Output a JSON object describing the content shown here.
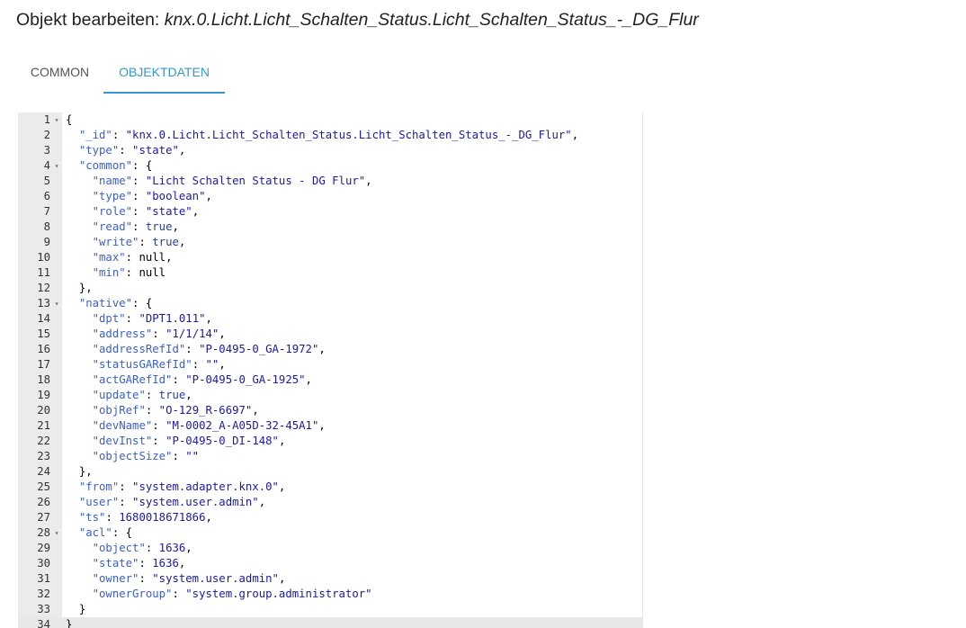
{
  "header": {
    "prefix": "Objekt bearbeiten: ",
    "object_id": "knx.0.Licht.Licht_Schalten_Status.Licht_Schalten_Status_-_DG_Flur"
  },
  "tabs": [
    {
      "label": "COMMON",
      "active": false
    },
    {
      "label": "OBJEKTDATEN",
      "active": true
    }
  ],
  "colors": {
    "accent": "#3399cc",
    "gutter": "#ebebeb",
    "key": "#3a5fcd",
    "string": "#1a1aa6"
  },
  "editor": {
    "lines": [
      {
        "n": "1",
        "fold": true,
        "indent": "",
        "parts": [
          {
            "t": "{",
            "c": "pun"
          }
        ]
      },
      {
        "n": "2",
        "indent": "  ",
        "parts": [
          {
            "t": "\"_id\"",
            "c": "key"
          },
          {
            "t": ": ",
            "c": "pun"
          },
          {
            "t": "\"knx.0.Licht.Licht_Schalten_Status.Licht_Schalten_Status_-_DG_Flur\"",
            "c": "str"
          },
          {
            "t": ",",
            "c": "pun"
          }
        ]
      },
      {
        "n": "3",
        "indent": "  ",
        "parts": [
          {
            "t": "\"type\"",
            "c": "key"
          },
          {
            "t": ": ",
            "c": "pun"
          },
          {
            "t": "\"state\"",
            "c": "str"
          },
          {
            "t": ",",
            "c": "pun"
          }
        ]
      },
      {
        "n": "4",
        "fold": true,
        "indent": "  ",
        "parts": [
          {
            "t": "\"common\"",
            "c": "key"
          },
          {
            "t": ": {",
            "c": "pun"
          }
        ]
      },
      {
        "n": "5",
        "indent": "    ",
        "parts": [
          {
            "t": "\"name\"",
            "c": "key"
          },
          {
            "t": ": ",
            "c": "pun"
          },
          {
            "t": "\"Licht Schalten Status - DG Flur\"",
            "c": "str"
          },
          {
            "t": ",",
            "c": "pun"
          }
        ]
      },
      {
        "n": "6",
        "indent": "    ",
        "parts": [
          {
            "t": "\"type\"",
            "c": "key"
          },
          {
            "t": ": ",
            "c": "pun"
          },
          {
            "t": "\"boolean\"",
            "c": "str"
          },
          {
            "t": ",",
            "c": "pun"
          }
        ]
      },
      {
        "n": "7",
        "indent": "    ",
        "parts": [
          {
            "t": "\"role\"",
            "c": "key"
          },
          {
            "t": ": ",
            "c": "pun"
          },
          {
            "t": "\"state\"",
            "c": "str"
          },
          {
            "t": ",",
            "c": "pun"
          }
        ]
      },
      {
        "n": "8",
        "indent": "    ",
        "parts": [
          {
            "t": "\"read\"",
            "c": "key"
          },
          {
            "t": ": ",
            "c": "pun"
          },
          {
            "t": "true",
            "c": "kw"
          },
          {
            "t": ",",
            "c": "pun"
          }
        ]
      },
      {
        "n": "9",
        "indent": "    ",
        "parts": [
          {
            "t": "\"write\"",
            "c": "key"
          },
          {
            "t": ": ",
            "c": "pun"
          },
          {
            "t": "true",
            "c": "kw"
          },
          {
            "t": ",",
            "c": "pun"
          }
        ]
      },
      {
        "n": "10",
        "indent": "    ",
        "parts": [
          {
            "t": "\"max\"",
            "c": "key"
          },
          {
            "t": ": null,",
            "c": "pun"
          }
        ]
      },
      {
        "n": "11",
        "indent": "    ",
        "parts": [
          {
            "t": "\"min\"",
            "c": "key"
          },
          {
            "t": ": null",
            "c": "pun"
          }
        ]
      },
      {
        "n": "12",
        "indent": "  ",
        "parts": [
          {
            "t": "},",
            "c": "pun"
          }
        ]
      },
      {
        "n": "13",
        "fold": true,
        "indent": "  ",
        "parts": [
          {
            "t": "\"native\"",
            "c": "key"
          },
          {
            "t": ": {",
            "c": "pun"
          }
        ]
      },
      {
        "n": "14",
        "indent": "    ",
        "parts": [
          {
            "t": "\"dpt\"",
            "c": "key"
          },
          {
            "t": ": ",
            "c": "pun"
          },
          {
            "t": "\"DPT1.011\"",
            "c": "str"
          },
          {
            "t": ",",
            "c": "pun"
          }
        ]
      },
      {
        "n": "15",
        "indent": "    ",
        "parts": [
          {
            "t": "\"address\"",
            "c": "key"
          },
          {
            "t": ": ",
            "c": "pun"
          },
          {
            "t": "\"1/1/14\"",
            "c": "str"
          },
          {
            "t": ",",
            "c": "pun"
          }
        ]
      },
      {
        "n": "16",
        "indent": "    ",
        "parts": [
          {
            "t": "\"addressRefId\"",
            "c": "key"
          },
          {
            "t": ": ",
            "c": "pun"
          },
          {
            "t": "\"P-0495-0_GA-1972\"",
            "c": "str"
          },
          {
            "t": ",",
            "c": "pun"
          }
        ]
      },
      {
        "n": "17",
        "indent": "    ",
        "parts": [
          {
            "t": "\"statusGARefId\"",
            "c": "key"
          },
          {
            "t": ": ",
            "c": "pun"
          },
          {
            "t": "\"\"",
            "c": "str"
          },
          {
            "t": ",",
            "c": "pun"
          }
        ]
      },
      {
        "n": "18",
        "indent": "    ",
        "parts": [
          {
            "t": "\"actGARefId\"",
            "c": "key"
          },
          {
            "t": ": ",
            "c": "pun"
          },
          {
            "t": "\"P-0495-0_GA-1925\"",
            "c": "str"
          },
          {
            "t": ",",
            "c": "pun"
          }
        ]
      },
      {
        "n": "19",
        "indent": "    ",
        "parts": [
          {
            "t": "\"update\"",
            "c": "key"
          },
          {
            "t": ": ",
            "c": "pun"
          },
          {
            "t": "true",
            "c": "kw"
          },
          {
            "t": ",",
            "c": "pun"
          }
        ]
      },
      {
        "n": "20",
        "indent": "    ",
        "parts": [
          {
            "t": "\"objRef\"",
            "c": "key"
          },
          {
            "t": ": ",
            "c": "pun"
          },
          {
            "t": "\"O-129_R-6697\"",
            "c": "str"
          },
          {
            "t": ",",
            "c": "pun"
          }
        ]
      },
      {
        "n": "21",
        "indent": "    ",
        "parts": [
          {
            "t": "\"devName\"",
            "c": "key"
          },
          {
            "t": ": ",
            "c": "pun"
          },
          {
            "t": "\"M-0002_A-A05D-32-45A1\"",
            "c": "str"
          },
          {
            "t": ",",
            "c": "pun"
          }
        ]
      },
      {
        "n": "22",
        "indent": "    ",
        "parts": [
          {
            "t": "\"devInst\"",
            "c": "key"
          },
          {
            "t": ": ",
            "c": "pun"
          },
          {
            "t": "\"P-0495-0_DI-148\"",
            "c": "str"
          },
          {
            "t": ",",
            "c": "pun"
          }
        ]
      },
      {
        "n": "23",
        "indent": "    ",
        "parts": [
          {
            "t": "\"objectSize\"",
            "c": "key"
          },
          {
            "t": ": ",
            "c": "pun"
          },
          {
            "t": "\"\"",
            "c": "str"
          }
        ]
      },
      {
        "n": "24",
        "indent": "  ",
        "parts": [
          {
            "t": "},",
            "c": "pun"
          }
        ]
      },
      {
        "n": "25",
        "indent": "  ",
        "parts": [
          {
            "t": "\"from\"",
            "c": "key"
          },
          {
            "t": ": ",
            "c": "pun"
          },
          {
            "t": "\"system.adapter.knx.0\"",
            "c": "str"
          },
          {
            "t": ",",
            "c": "pun"
          }
        ]
      },
      {
        "n": "26",
        "indent": "  ",
        "parts": [
          {
            "t": "\"user\"",
            "c": "key"
          },
          {
            "t": ": ",
            "c": "pun"
          },
          {
            "t": "\"system.user.admin\"",
            "c": "str"
          },
          {
            "t": ",",
            "c": "pun"
          }
        ]
      },
      {
        "n": "27",
        "indent": "  ",
        "parts": [
          {
            "t": "\"ts\"",
            "c": "key"
          },
          {
            "t": ": ",
            "c": "pun"
          },
          {
            "t": "1680018671866",
            "c": "num"
          },
          {
            "t": ",",
            "c": "pun"
          }
        ]
      },
      {
        "n": "28",
        "fold": true,
        "indent": "  ",
        "parts": [
          {
            "t": "\"acl\"",
            "c": "key"
          },
          {
            "t": ": {",
            "c": "pun"
          }
        ]
      },
      {
        "n": "29",
        "indent": "    ",
        "parts": [
          {
            "t": "\"object\"",
            "c": "key"
          },
          {
            "t": ": ",
            "c": "pun"
          },
          {
            "t": "1636",
            "c": "num"
          },
          {
            "t": ",",
            "c": "pun"
          }
        ]
      },
      {
        "n": "30",
        "indent": "    ",
        "parts": [
          {
            "t": "\"state\"",
            "c": "key"
          },
          {
            "t": ": ",
            "c": "pun"
          },
          {
            "t": "1636",
            "c": "num"
          },
          {
            "t": ",",
            "c": "pun"
          }
        ]
      },
      {
        "n": "31",
        "indent": "    ",
        "parts": [
          {
            "t": "\"owner\"",
            "c": "key"
          },
          {
            "t": ": ",
            "c": "pun"
          },
          {
            "t": "\"system.user.admin\"",
            "c": "str"
          },
          {
            "t": ",",
            "c": "pun"
          }
        ]
      },
      {
        "n": "32",
        "indent": "    ",
        "parts": [
          {
            "t": "\"ownerGroup\"",
            "c": "key"
          },
          {
            "t": ": ",
            "c": "pun"
          },
          {
            "t": "\"system.group.administrator\"",
            "c": "str"
          }
        ]
      },
      {
        "n": "33",
        "indent": "  ",
        "parts": [
          {
            "t": "}",
            "c": "pun"
          }
        ]
      },
      {
        "n": "34",
        "active": true,
        "indent": "",
        "parts": [
          {
            "t": "}",
            "c": "pun"
          }
        ]
      }
    ]
  }
}
